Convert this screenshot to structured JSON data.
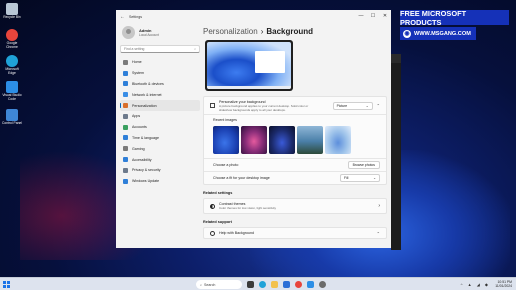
{
  "desktop": {
    "icons": [
      {
        "label": "Recycle Bin",
        "icon": "recycle-bin-icon",
        "color": "#b9c7d6"
      },
      {
        "label": "Google Chrome",
        "icon": "chrome-icon",
        "color": "#e8453c"
      },
      {
        "label": "Microsoft Edge",
        "icon": "edge-icon",
        "color": "#1fa2d8"
      },
      {
        "label": "Visual Studio Code",
        "icon": "vscode-icon",
        "color": "#2c8ee6"
      },
      {
        "label": "Control Panel",
        "icon": "control-panel-icon",
        "color": "#3f86d6"
      }
    ]
  },
  "overlay": {
    "banner": "FREE MICROSOFT PRODUCTS",
    "site": "WWW.MSGANG.COM"
  },
  "settings": {
    "window_title": "Settings",
    "controls": {
      "minimize": "—",
      "maximize": "☐",
      "close": "✕"
    },
    "account": {
      "name": "Admin",
      "type": "Local Account"
    },
    "search_placeholder": "Find a setting",
    "nav": [
      {
        "label": "Home",
        "icon": "home-icon",
        "color": "#7a7a7a"
      },
      {
        "label": "System",
        "icon": "system-icon",
        "color": "#2f7fd8"
      },
      {
        "label": "Bluetooth & devices",
        "icon": "bluetooth-icon",
        "color": "#2f7fd8"
      },
      {
        "label": "Network & internet",
        "icon": "network-icon",
        "color": "#3a8ee6"
      },
      {
        "label": "Personalization",
        "icon": "personalization-icon",
        "color": "#d86e2b",
        "selected": true
      },
      {
        "label": "Apps",
        "icon": "apps-icon",
        "color": "#6d7a8c"
      },
      {
        "label": "Accounts",
        "icon": "accounts-icon",
        "color": "#3aa060"
      },
      {
        "label": "Time & language",
        "icon": "time-language-icon",
        "color": "#2f7fd8"
      },
      {
        "label": "Gaming",
        "icon": "gaming-icon",
        "color": "#7a7a7a"
      },
      {
        "label": "Accessibility",
        "icon": "accessibility-icon",
        "color": "#2f7fd8"
      },
      {
        "label": "Privacy & security",
        "icon": "privacy-icon",
        "color": "#6d7a8c"
      },
      {
        "label": "Windows Update",
        "icon": "windows-update-icon",
        "color": "#2f7fd8"
      }
    ],
    "breadcrumb": {
      "parent": "Personalization",
      "separator": "›",
      "current": "Background"
    },
    "personalize": {
      "title": "Personalize your background",
      "subtitle": "A picture background applies to your current desktop. Solid color or slideshow backgrounds apply to all your desktops.",
      "value": "Picture"
    },
    "recent_label": "Recent images",
    "recent_thumbs": [
      {
        "name": "thumb-bloom-blue",
        "color": "#2350c8"
      },
      {
        "name": "thumb-purple-glow",
        "color": "#8b2e7a"
      },
      {
        "name": "thumb-dark-bloom",
        "color": "#1b2a6b"
      },
      {
        "name": "thumb-landscape",
        "color": "#4a7fa8"
      },
      {
        "name": "thumb-light-bloom",
        "color": "#9ec3ea"
      }
    ],
    "choose_photo": {
      "label": "Choose a photo",
      "button": "Browse photos"
    },
    "choose_fit": {
      "label": "Choose a fit for your desktop image",
      "value": "Fill"
    },
    "related_settings": "Related settings",
    "contrast": {
      "title": "Contrast themes",
      "subtitle": "Color themes for low vision, light sensitivity"
    },
    "related_support": "Related support",
    "help": "Help with Background"
  },
  "taskbar": {
    "search": "Search",
    "apps": [
      {
        "name": "task-view-icon",
        "color": "#3b3b3b"
      },
      {
        "name": "edge-icon",
        "color": "#1fa2d8"
      },
      {
        "name": "file-explorer-icon",
        "color": "#f2c14e"
      },
      {
        "name": "store-icon",
        "color": "#2c6fd6"
      },
      {
        "name": "chrome-icon",
        "color": "#e8453c"
      },
      {
        "name": "vscode-icon",
        "color": "#2c8ee6"
      },
      {
        "name": "settings-icon",
        "color": "#6b6b6b"
      }
    ],
    "tray": "^  ▲ ◢ ◆",
    "time": "10:51 PM",
    "date": "11/01/2024"
  }
}
